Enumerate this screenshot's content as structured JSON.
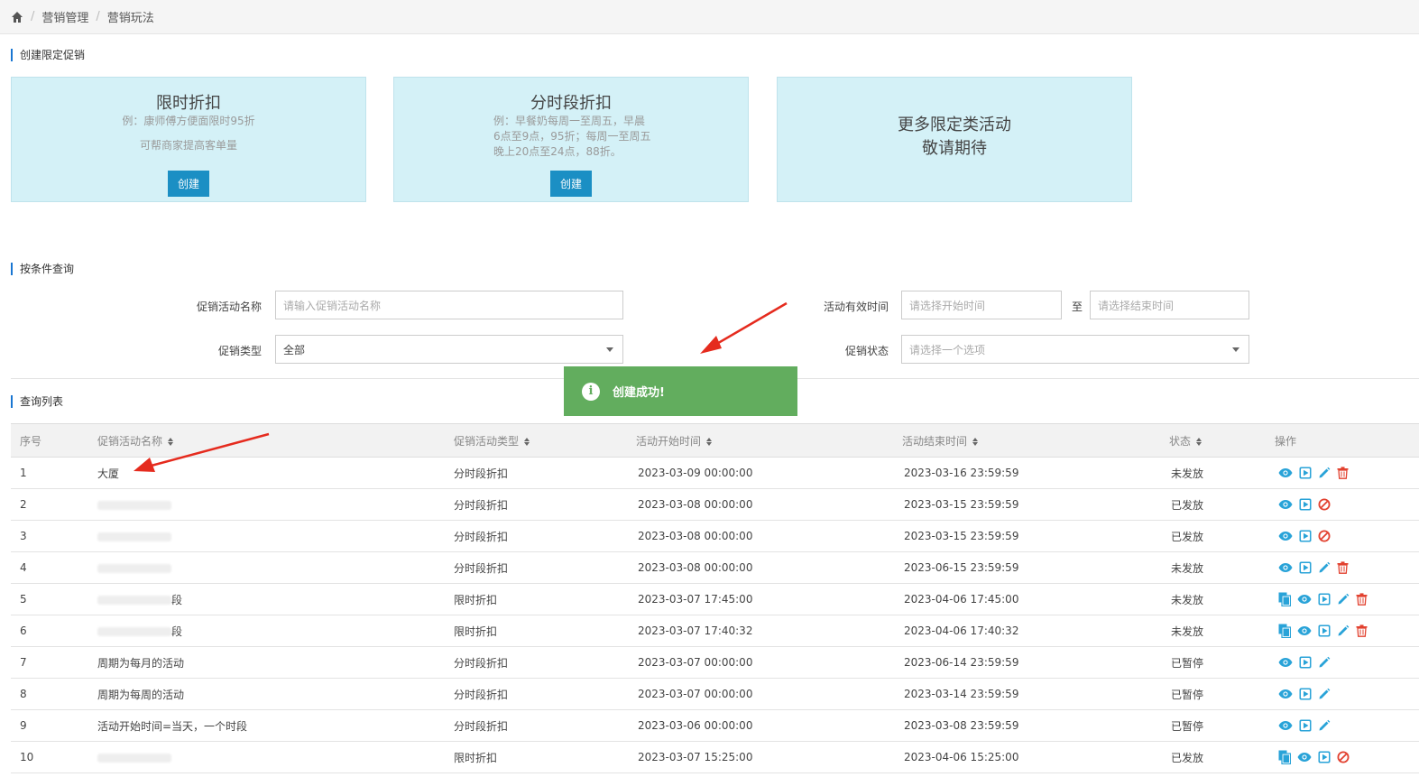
{
  "breadcrumb": {
    "items": [
      "营销管理",
      "营销玩法"
    ]
  },
  "create_section": {
    "title": "创建限定促销"
  },
  "cards": [
    {
      "title": "限时折扣",
      "desc_lines": [
        "例：康师傅方便面限时95折"
      ],
      "extra": "可帮商家提高客单量",
      "button": "创建"
    },
    {
      "title": "分时段折扣",
      "desc_lines": [
        "例：早餐奶每周一至周五，早晨",
        "6点至9点，95折；每周一至周五",
        "晚上20点至24点，88折。"
      ],
      "button": "创建"
    },
    {
      "lines": [
        "更多限定类活动",
        "敬请期待"
      ]
    }
  ],
  "query_section": {
    "title": "按条件查询",
    "name_label": "促销活动名称",
    "name_placeholder": "请输入促销活动名称",
    "time_label": "活动有效时间",
    "start_placeholder": "请选择开始时间",
    "to": "至",
    "end_placeholder": "请选择结束时间",
    "type_label": "促销类型",
    "type_value": "全部",
    "status_label": "促销状态",
    "status_placeholder": "请选择一个选项"
  },
  "toast": {
    "message": "创建成功!"
  },
  "list_section": {
    "title": "查询列表"
  },
  "table": {
    "headers": [
      "序号",
      "促销活动名称",
      "促销活动类型",
      "活动开始时间",
      "活动结束时间",
      "状态",
      "操作"
    ],
    "rows": [
      {
        "no": "1",
        "name": "大厦",
        "type": "分时段折扣",
        "start": "2023-03-09 00:00:00",
        "end": "2023-03-16 23:59:59",
        "status": "未发放",
        "ops": [
          "view",
          "play",
          "edit",
          "delete"
        ]
      },
      {
        "no": "2",
        "name": "",
        "type": "分时段折扣",
        "start": "2023-03-08 00:00:00",
        "end": "2023-03-15 23:59:59",
        "status": "已发放",
        "ops": [
          "view",
          "play",
          "stop"
        ]
      },
      {
        "no": "3",
        "name": "",
        "type": "分时段折扣",
        "start": "2023-03-08 00:00:00",
        "end": "2023-03-15 23:59:59",
        "status": "已发放",
        "ops": [
          "view",
          "play",
          "stop"
        ]
      },
      {
        "no": "4",
        "name": "",
        "type": "分时段折扣",
        "start": "2023-03-08 00:00:00",
        "end": "2023-06-15 23:59:59",
        "status": "未发放",
        "ops": [
          "view",
          "play",
          "edit",
          "delete"
        ]
      },
      {
        "no": "5",
        "name": "段",
        "type": "限时折扣",
        "start": "2023-03-07 17:45:00",
        "end": "2023-04-06 17:45:00",
        "status": "未发放",
        "ops": [
          "copy",
          "view",
          "play",
          "edit",
          "delete"
        ]
      },
      {
        "no": "6",
        "name": "段",
        "type": "限时折扣",
        "start": "2023-03-07 17:40:32",
        "end": "2023-04-06 17:40:32",
        "status": "未发放",
        "ops": [
          "copy",
          "view",
          "play",
          "edit",
          "delete"
        ]
      },
      {
        "no": "7",
        "name": "周期为每月的活动",
        "type": "分时段折扣",
        "start": "2023-03-07 00:00:00",
        "end": "2023-06-14 23:59:59",
        "status": "已暂停",
        "ops": [
          "view",
          "play",
          "edit"
        ]
      },
      {
        "no": "8",
        "name": "周期为每周的活动",
        "type": "分时段折扣",
        "start": "2023-03-07 00:00:00",
        "end": "2023-03-14 23:59:59",
        "status": "已暂停",
        "ops": [
          "view",
          "play",
          "edit"
        ]
      },
      {
        "no": "9",
        "name": "活动开始时间=当天，一个时段",
        "type": "分时段折扣",
        "start": "2023-03-06 00:00:00",
        "end": "2023-03-08 23:59:59",
        "status": "已暂停",
        "ops": [
          "view",
          "play",
          "edit"
        ]
      },
      {
        "no": "10",
        "name": "",
        "type": "限时折扣",
        "start": "2023-03-07 15:25:00",
        "end": "2023-04-06 15:25:00",
        "status": "已发放",
        "ops": [
          "copy",
          "view",
          "play",
          "stop"
        ]
      }
    ]
  },
  "colors": {
    "accent": "#1b8fc4",
    "card_bg": "#d4f1f7",
    "toast_bg": "#62ad5e",
    "icon_blue": "#29a3d8",
    "icon_red": "#e2412f",
    "arrow_red": "#e52b1e"
  }
}
